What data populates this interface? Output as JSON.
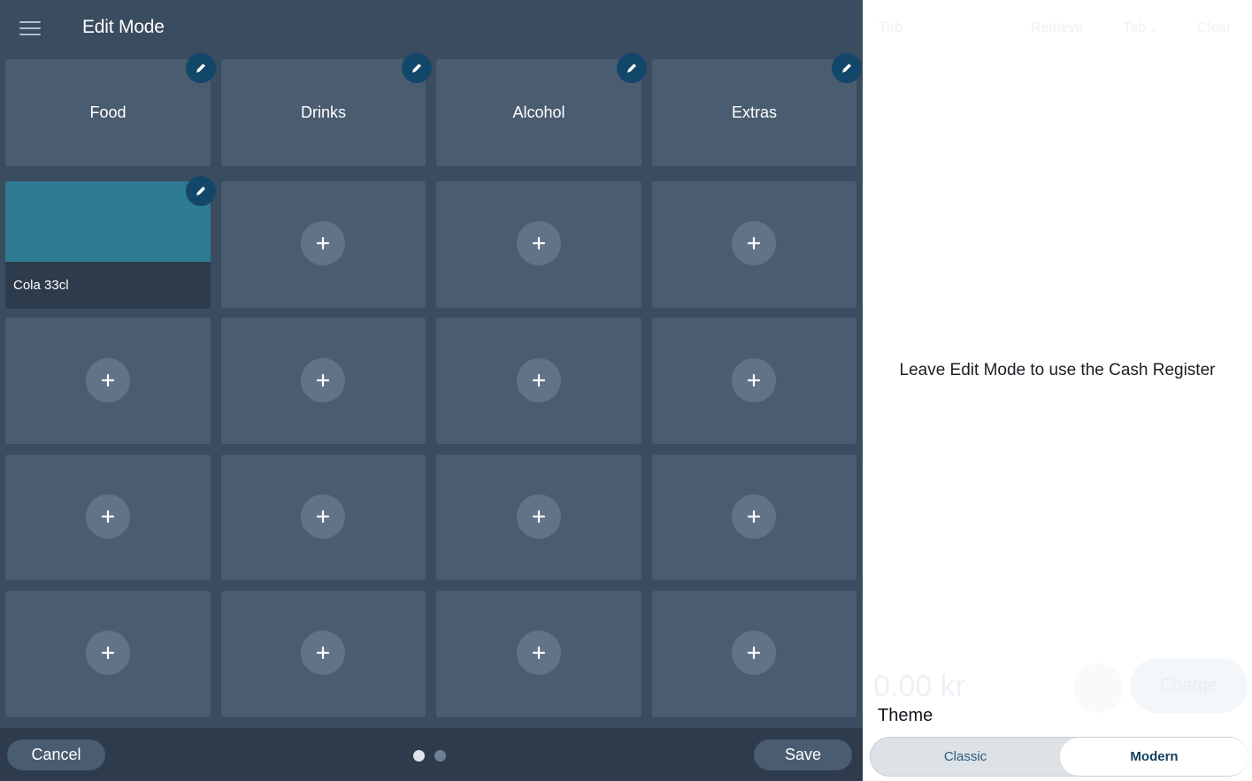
{
  "header": {
    "title": "Edit Mode"
  },
  "categories": [
    {
      "label": "Food"
    },
    {
      "label": "Drinks"
    },
    {
      "label": "Alcohol"
    },
    {
      "label": "Extras"
    }
  ],
  "products": [
    {
      "name": "Cola 33cl",
      "color": "#2e7b91"
    }
  ],
  "footer": {
    "cancel_label": "Cancel",
    "save_label": "Save",
    "pages": 2,
    "current_page": 1
  },
  "register": {
    "tab_label": "Tab",
    "retrieve_label": "Retrieve",
    "tab_menu_label": "Tab",
    "clear_label": "Clear",
    "notice": "Leave Edit Mode to use the Cash Register",
    "total": "0.00 kr",
    "charge_label": "Charge"
  },
  "theme": {
    "label": "Theme",
    "options": [
      "Classic",
      "Modern"
    ],
    "selected": "Modern"
  },
  "colors": {
    "panel_bg": "#3a4c5f",
    "tile_bg": "#4a5c70",
    "edit_badge": "#13476a",
    "product_accent": "#2e7b91"
  }
}
